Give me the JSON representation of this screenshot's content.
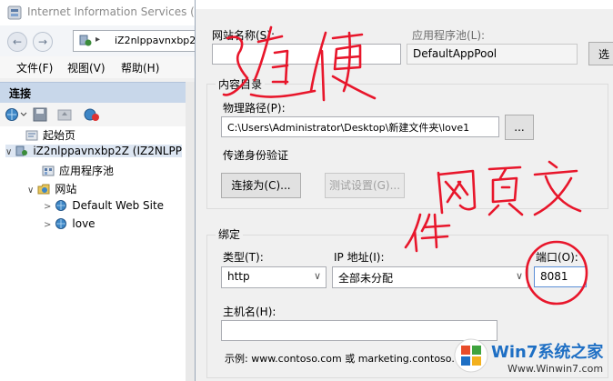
{
  "iis": {
    "title": "Internet Information Services (II",
    "address": "iZ2nlppavnxbp2",
    "menu": [
      "文件(F)",
      "视图(V)",
      "帮助(H)"
    ],
    "connections_label": "连接",
    "tree": [
      {
        "label": "起始页",
        "icon": "start-page-icon"
      },
      {
        "label": "iZ2nlppavnxbp2Z (IZ2NLPP",
        "icon": "server-icon"
      },
      {
        "label": "应用程序池",
        "icon": "app-pool-icon"
      },
      {
        "label": "网站",
        "icon": "sites-folder-icon"
      },
      {
        "label": "Default Web Site",
        "icon": "globe-icon"
      },
      {
        "label": "love",
        "icon": "globe-icon"
      }
    ]
  },
  "dialog": {
    "site_name_label": "网站名称(S):",
    "site_name_value": "",
    "app_pool_label": "应用程序池(L):",
    "app_pool_value": "DefaultAppPool",
    "select_button_partial": "选",
    "content_dir_label": "内容目录",
    "physical_path_label": "物理路径(P):",
    "physical_path_value": "C:\\Users\\Administrator\\Desktop\\新建文件夹\\love1",
    "browse_label": "...",
    "passthrough_label": "传递身份验证",
    "connect_as_label": "连接为(C)...",
    "test_settings_label": "测试设置(G)...",
    "binding_label": "绑定",
    "type_label": "类型(T):",
    "type_value": "http",
    "ip_label": "IP 地址(I):",
    "ip_value": "全部未分配",
    "port_label": "端口(O):",
    "port_value": "8081",
    "hostname_label": "主机名(H):",
    "hostname_value": "",
    "example_text": "示例: www.contoso.com 或 marketing.contoso.com"
  },
  "watermark": {
    "brand": "Win7系统之家",
    "url": "Www.Winwin7.com"
  },
  "colors": {
    "ink": "#e8162b",
    "connections_header": "#c8d7ea",
    "logo_green": "#3fa33f",
    "logo_blue": "#1e6fc4"
  }
}
